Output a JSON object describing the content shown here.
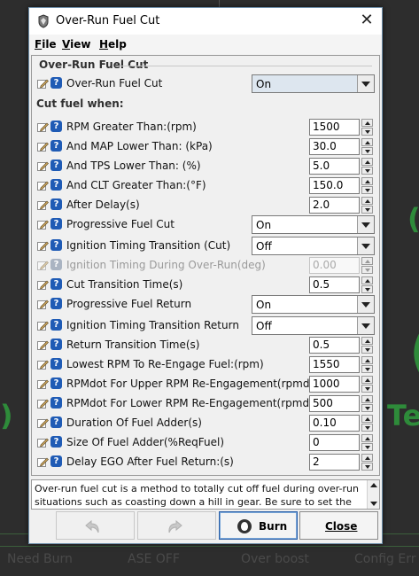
{
  "background": {
    "status_items": [
      "Need Burn",
      "ASE OFF",
      "Over boost",
      "Config Err"
    ],
    "right_glyph_1": "(",
    "right_glyph_2": "(",
    "right_text": "Te",
    "left_glyph": ")"
  },
  "window": {
    "title": "Over-Run Fuel Cut",
    "close_glyph": "✕"
  },
  "menu": {
    "file": "File",
    "view": "View",
    "help": "Help"
  },
  "group": {
    "title": "Over-Run Fuel Cut",
    "cut_fuel_when": "Cut fuel when:"
  },
  "help_glyph": "?",
  "rows": [
    {
      "label": "Over-Run Fuel Cut",
      "type": "combo",
      "value": "On"
    },
    {
      "label": "RPM Greater Than:(rpm)",
      "type": "spin",
      "value": "1500"
    },
    {
      "label": "And MAP Lower Than:  (kPa)",
      "type": "spin",
      "value": "30.0"
    },
    {
      "label": "And TPS Lower Than:  (%)",
      "type": "spin",
      "value": "5.0"
    },
    {
      "label": "And CLT Greater Than:(°F)",
      "type": "spin",
      "value": "150.0"
    },
    {
      "label": "After Delay(s)",
      "type": "spin",
      "value": "2.0"
    },
    {
      "label": "Progressive Fuel Cut",
      "type": "combo",
      "value": "On"
    },
    {
      "label": "Ignition Timing Transition (Cut)",
      "type": "combo",
      "value": "Off"
    },
    {
      "label": "Ignition Timing During Over-Run(deg)",
      "type": "spin",
      "value": "0.00",
      "disabled": true
    },
    {
      "label": "Cut Transition Time(s)",
      "type": "spin",
      "value": "0.5"
    },
    {
      "label": "Progressive Fuel Return",
      "type": "combo",
      "value": "On"
    },
    {
      "label": "Ignition Timing Transition Return",
      "type": "combo",
      "value": "Off"
    },
    {
      "label": "Return Transition Time(s)",
      "type": "spin",
      "value": "0.5"
    },
    {
      "label": "Lowest RPM To Re-Engage Fuel:(rpm)",
      "type": "spin",
      "value": "1550"
    },
    {
      "label": "RPMdot For Upper RPM Re-Engagement(rpmdot)",
      "type": "spin",
      "value": "1000"
    },
    {
      "label": "RPMdot For Lower RPM Re-Engagement(rpmdot)",
      "type": "spin",
      "value": "500"
    },
    {
      "label": "Duration Of Fuel Adder(s)",
      "type": "spin",
      "value": "0.10"
    },
    {
      "label": "Size Of Fuel Adder(%ReqFuel)",
      "type": "spin",
      "value": "0"
    },
    {
      "label": "Delay EGO After Fuel Return:(s)",
      "type": "spin",
      "value": "2"
    }
  ],
  "description": "Over-run fuel cut is a method to totally cut off fuel during over-run situations such as coasting down a hill in gear. Be sure to set the",
  "buttons": {
    "burn": "Burn",
    "close": "Close"
  },
  "colors": {
    "help_icon": "#1f5bb5",
    "background_green": "#2e8b3a"
  }
}
